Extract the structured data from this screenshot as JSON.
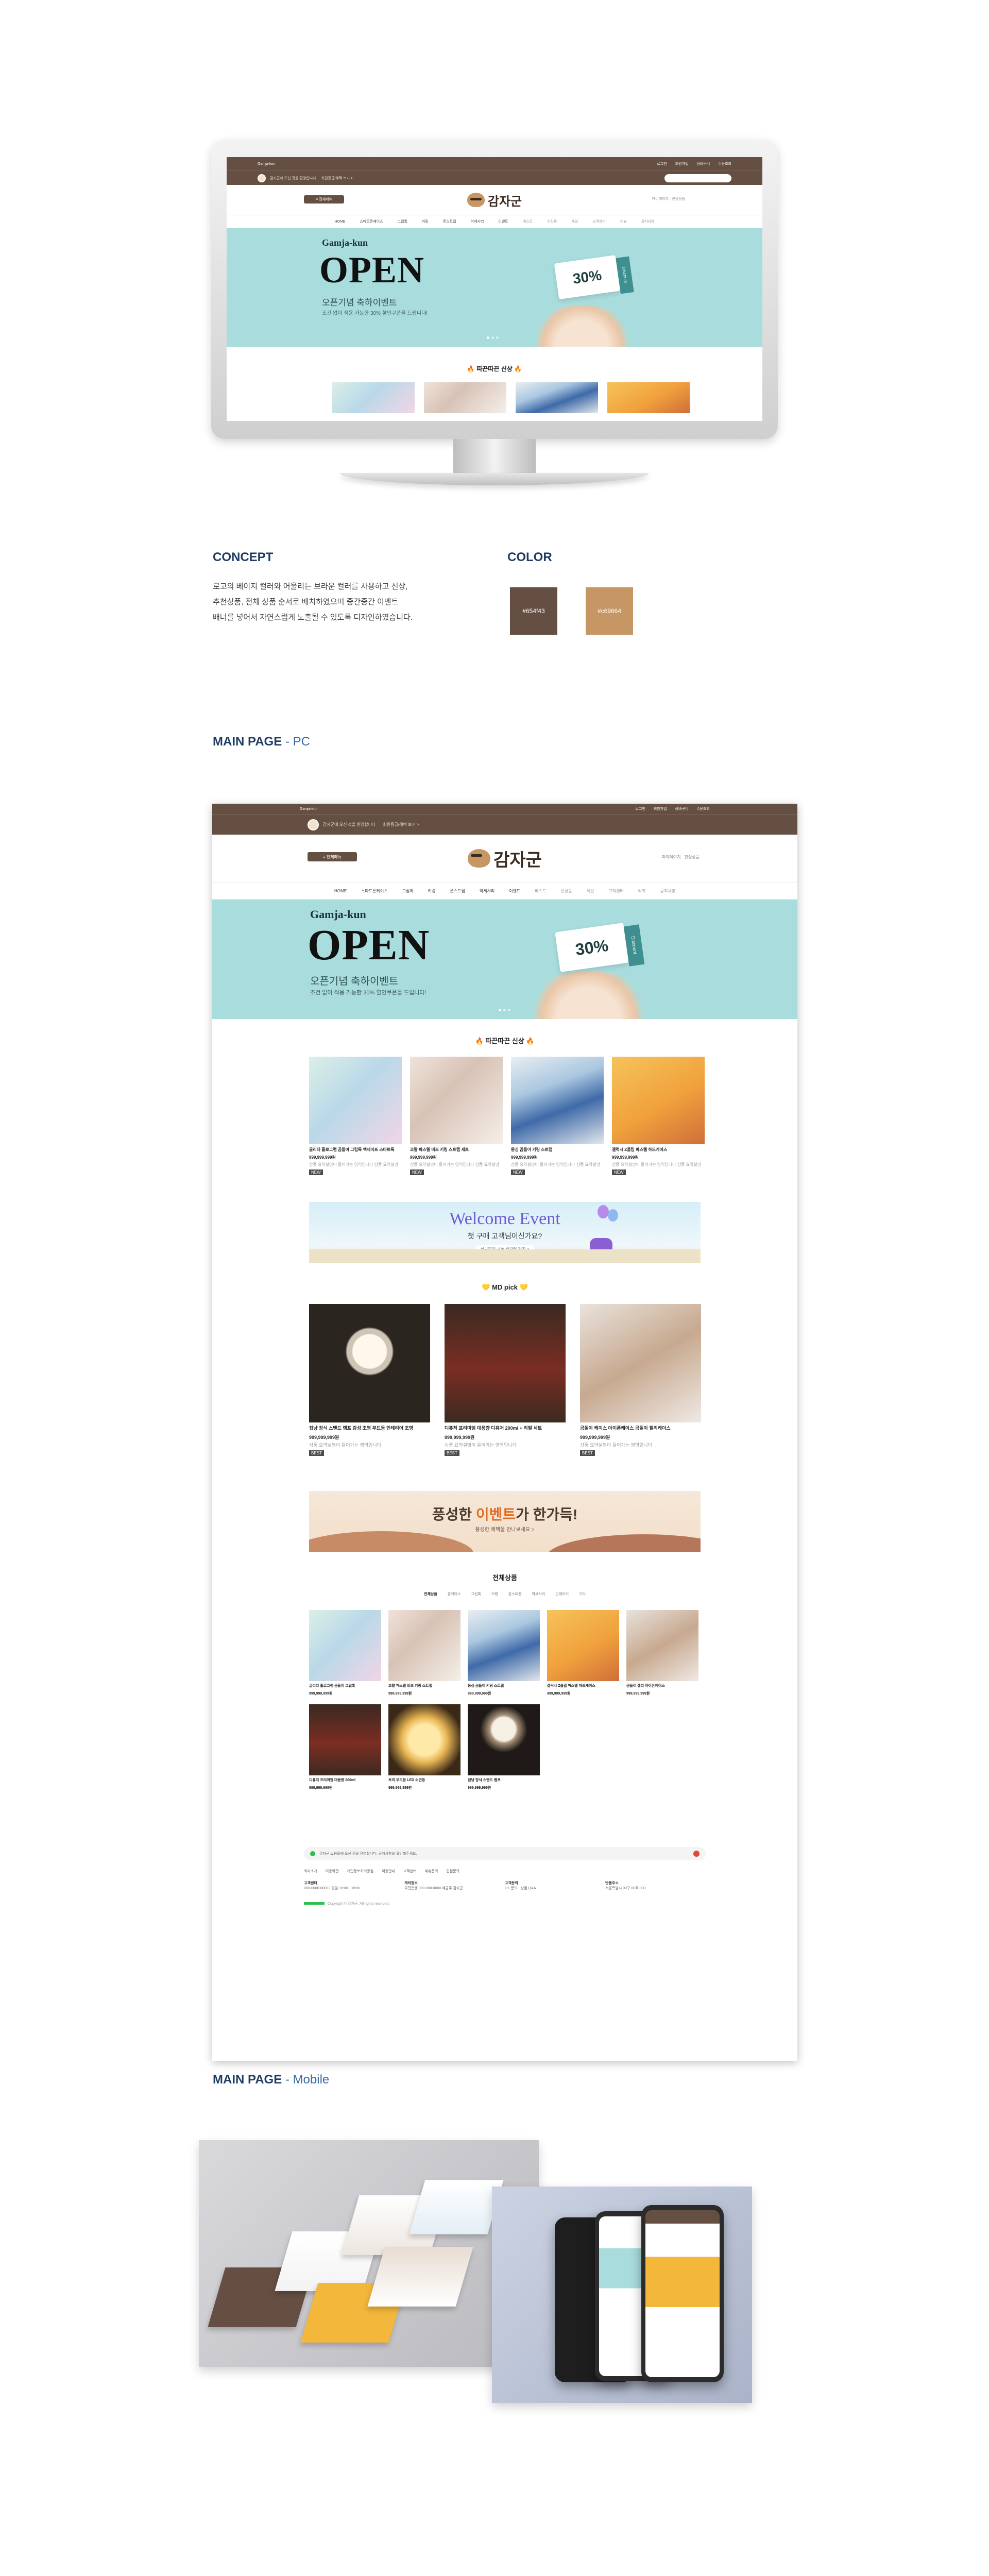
{
  "site": {
    "brand": "감자군",
    "topbar_left": "Gamja-kun",
    "topbar_links": [
      "로그인",
      "회원가입",
      "장바구니",
      "주문조회"
    ],
    "greeting": "감자군에 오신 것을 환영합니다",
    "greeting_sub": "회원등급/혜택 보기 >",
    "search_placeholder": "검색어를 입력하세요",
    "menu_button": "≡ 전체메뉴",
    "right_util": "마이페이지 · 관심상품",
    "nav": [
      "HOME",
      "스마트폰케이스",
      "그립톡",
      "키링",
      "폰스트랩",
      "악세사리",
      "이벤트"
    ],
    "nav_muted": [
      "베스트",
      "신상품",
      "세일",
      "고객센터",
      "리뷰",
      "공지사항"
    ],
    "hero": {
      "kicker": "Gamja-kun",
      "title": "OPEN",
      "sub": "오픈기념 축하이벤트",
      "desc": "조건 없이 적용 가능한 30% 할인쿠폰을 드립니다!",
      "coupon": "30%",
      "coupon_tab": "Discount"
    },
    "new_title": "🔥 따끈따끈 신상 🔥",
    "new_products": [
      {
        "name": "글리터 홀로그램 곰돌이 그립톡 맥세이프 스마트톡",
        "price": "999,999,999원",
        "meta": "상품 요약설명이 들어가는 영역입니다 상품 요약설명",
        "tag": "NEW"
      },
      {
        "name": "코랄 파스텔 비즈 키링 스트랩 세트",
        "price": "999,999,999원",
        "meta": "상품 요약설명이 들어가는 영역입니다 상품 요약설명",
        "tag": "NEW"
      },
      {
        "name": "동심 곰돌이 키링 스트랩",
        "price": "999,999,999원",
        "meta": "상품 요약설명이 들어가는 영역입니다 상품 요약설명",
        "tag": "NEW"
      },
      {
        "name": "갤럭시 Z플립 파스텔 하드케이스",
        "price": "999,999,999원",
        "meta": "상품 요약설명이 들어가는 영역입니다 상품 요약설명",
        "tag": "NEW"
      }
    ],
    "welcome": {
      "title": "Welcome  Event",
      "sub": "첫 구매 고객님이신가요?",
      "button": "신규회원 쿠폰 받으러 가기 >"
    },
    "md_title": "💛 MD pick 💛",
    "md_products": [
      {
        "name": "집냥 장식 스탠드 램프 감성 조명 무드등 인테리어 조명",
        "price": "999,999,999원",
        "meta": "상품 요약설명이 들어가는 영역입니다",
        "tag": "BEST"
      },
      {
        "name": "디퓨저 프리미엄 대용량 디퓨저 200ml + 리필 세트",
        "price": "999,999,999원",
        "meta": "상품 요약설명이 들어가는 영역입니다",
        "tag": "BEST"
      },
      {
        "name": "곰돌이 케이스 아이폰케이스 곰돌이 젤리케이스",
        "price": "999,999,999원",
        "meta": "상품 요약설명이 들어가는 영역입니다",
        "tag": "BEST"
      }
    ],
    "autumn": {
      "title_a": "풍성한 ",
      "title_b": "이벤트",
      "title_c": "가 한가득!",
      "sub": "풍성한 혜택을 만나보세요 >"
    },
    "all_title": "전체상품",
    "all_tabs": [
      "전체상품",
      "폰케이스",
      "그립톡",
      "키링",
      "폰스트랩",
      "악세사리",
      "인테리어",
      "기타"
    ],
    "all_products": [
      {
        "name": "글리터 홀로그램 곰돌이 그립톡",
        "price": "999,999,999원"
      },
      {
        "name": "코랄 파스텔 비즈 키링 스트랩",
        "price": "999,999,999원"
      },
      {
        "name": "동심 곰돌이 키링 스트랩",
        "price": "999,999,999원"
      },
      {
        "name": "갤럭시 Z플립 파스텔 하드케이스",
        "price": "999,999,999원"
      },
      {
        "name": "곰돌이 젤리 아이폰케이스",
        "price": "999,999,999원"
      },
      {
        "name": "디퓨저 프리미엄 대용량 200ml",
        "price": "999,999,999원"
      },
      {
        "name": "토끼 무드등 LED 수면등",
        "price": "999,999,999원"
      },
      {
        "name": "집냥 장식 스탠드 램프",
        "price": "999,999,999원"
      }
    ],
    "footer": {
      "notice": "감자군 쇼핑몰에 오신 것을 환영합니다. 공지사항을 확인해주세요.",
      "links": [
        "회사소개",
        "이용약관",
        "개인정보처리방침",
        "이용안내",
        "고객센터",
        "제휴문의",
        "입점문의"
      ],
      "col1_title": "고객센터",
      "col1": "000-0000-0000 / 평일 10:00 - 18:00",
      "col2_title": "계좌정보",
      "col2": "국민은행 000-000-0000 예금주 감자군",
      "col3_title": "고객문의",
      "col3": "1:1 문의 · 상품 Q&A",
      "col4_title": "반품주소",
      "col4": "서울특별시 00구 00로 000",
      "copyright": "Copyright © 감자군. All rights reserved."
    }
  },
  "sections": {
    "concept_title": "CONCEPT",
    "concept_text": [
      "로고의 베이지 컬러와 어울리는 브라운 컬러를 사용하고 신상,",
      "추천상품, 전체 상품 순서로 배치하였으며 중간중간 이벤트",
      "배너를 넣어서 자연스럽게 노출될 수 있도록 디자인하였습니다."
    ],
    "color_title": "COLOR",
    "colors": [
      {
        "label": "#654f43",
        "hex": "#654f43"
      },
      {
        "label": "#c69664",
        "hex": "#c69664"
      }
    ],
    "pc_title": "MAIN PAGE",
    "pc_suffix": " - PC",
    "mobile_title": "MAIN PAGE",
    "mobile_suffix": " - Mobile"
  },
  "colors": {
    "brand_brown": "#654f43",
    "brand_beige": "#c69664",
    "hero_mint": "#a9dcdc",
    "heading_navy": "#1f3c63"
  }
}
